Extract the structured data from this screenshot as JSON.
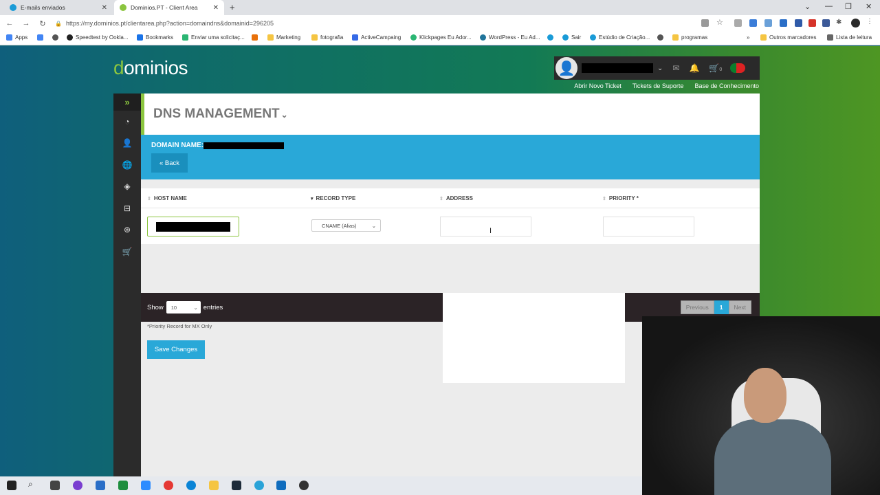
{
  "browser": {
    "tabs": [
      {
        "label": "E-mails enviados",
        "active": false,
        "color": "#1a9bd7"
      },
      {
        "label": "Dominios.PT - Client Area",
        "active": true,
        "color": "#8bc53f"
      }
    ],
    "url": "https://my.dominios.pt/clientarea.php?action=domaindns&domainid=296205",
    "bookmarks": [
      "Apps",
      "Speedtest by Ookla...",
      "Bookmarks",
      "Enviar uma solicitaç...",
      "Marketing",
      "fotografia",
      "ActiveCampaing",
      "Klickpages Eu Ador...",
      "WordPress - Eu Ad...",
      "Sair",
      "Estúdio de Criação...",
      "programas"
    ],
    "other_bookmarks": "Outros marcadores",
    "reading_list": "Lista de leitura"
  },
  "header": {
    "logo_d": "d",
    "logo_rest": "ominios",
    "cart_count": "0",
    "links": [
      "Abrir Novo Ticket",
      "Tickets de Suporte",
      "Base de Conhecimento"
    ]
  },
  "page": {
    "title": "DNS MANAGEMENT",
    "domain_label": "DOMAIN NAME:",
    "back_label": "« Back"
  },
  "table": {
    "columns": [
      "HOST NAME",
      "RECORD TYPE",
      "ADDRESS",
      "PRIORITY *"
    ],
    "record_type_value": "CNAME (Alias)",
    "address_value": "",
    "priority_value": ""
  },
  "footer": {
    "show_label": "Show",
    "entries_value": "10",
    "entries_label": "entries",
    "previous": "Previous",
    "current_page": "1",
    "next": "Next",
    "note": "*Priority Record for MX Only",
    "save_label": "Save Changes"
  },
  "colors": {
    "accent_green": "#8bc53f",
    "accent_blue": "#29a8d8"
  }
}
